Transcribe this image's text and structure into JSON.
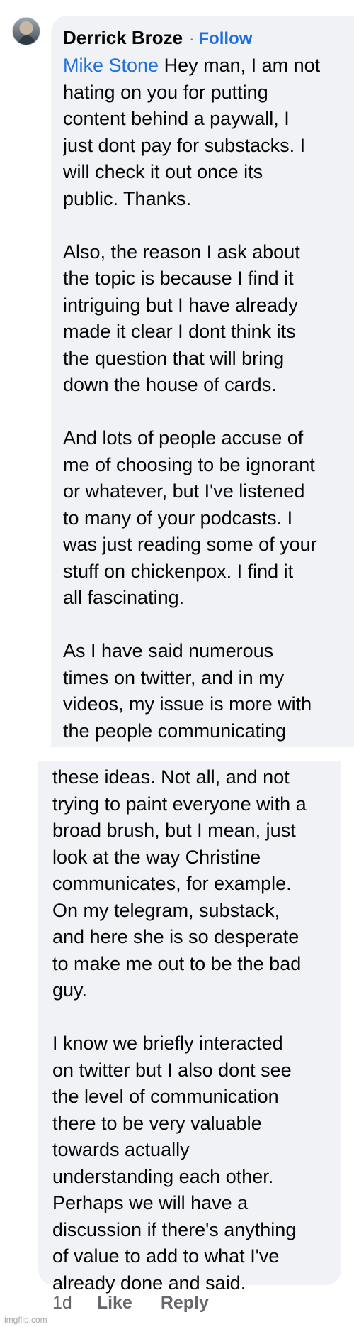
{
  "comment": {
    "author": "Derrick Broze",
    "separator": "·",
    "follow_label": "Follow",
    "mention": "Mike Stone",
    "part1_text": " Hey man, I am not\nhating on you for putting\ncontent behind a paywall, I\njust dont pay for substacks. I\nwill check it out once its\npublic. Thanks.\n\nAlso, the reason I ask about\nthe topic is because I find it\nintriguing but I have already\nmade it clear I dont think its\nthe question that will bring\ndown the house of cards.\n\nAnd lots of people accuse of\nme of choosing to be ignorant\nor whatever, but I've listened\nto many of your podcasts. I\nwas just reading some of your\nstuff on chickenpox. I find it\nall fascinating.\n\nAs I have said numerous\ntimes on twitter, and in my\nvideos, my issue is more with\nthe people communicating",
    "part2_text": "these ideas. Not all, and not\ntrying to paint everyone with a\nbroad brush, but I mean, just\nlook at the way Christine\ncommunicates, for example.\nOn my telegram, substack,\nand here she is so desperate\nto make me out to be the bad\nguy.\n\nI know we briefly interacted\non twitter but I also dont see\nthe level of communication\nthere to be very valuable\ntowards actually\nunderstanding each other.\nPerhaps we will have a\ndiscussion if there's anything\nof value to add to what I've\nalready done and said.",
    "timestamp": "1d",
    "like_label": "Like",
    "reply_label": "Reply"
  },
  "watermark": "imgflip.com",
  "colors": {
    "link": "#216fdb",
    "bubble": "#f0f2f5",
    "meta": "#65676b"
  }
}
